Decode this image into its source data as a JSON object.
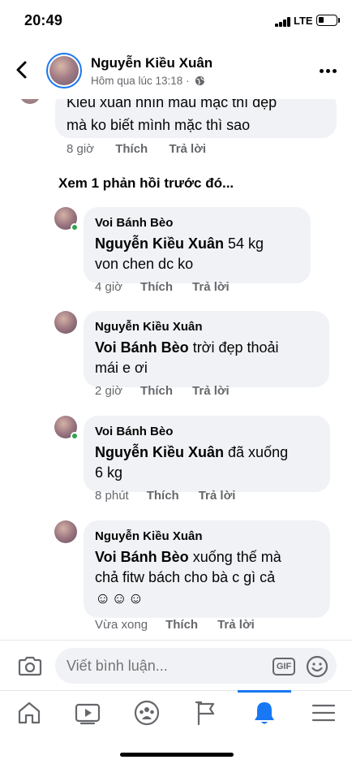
{
  "status_bar": {
    "time": "20:49",
    "network": "LTE"
  },
  "header": {
    "name": "Nguyễn Kiều Xuân",
    "subtitle": "Hôm qua lúc 13:18 · "
  },
  "partial_comment": {
    "line1": "Kiều xuân nhìn mẫu mặc  thì đẹp",
    "line2": "mà ko biết mình mặc thì sao",
    "time": "8 giờ",
    "like": "Thích",
    "reply": "Trả lời"
  },
  "view_previous": "Xem 1 phản hồi trước đó...",
  "replies": [
    {
      "author": "Voi Bánh Bèo",
      "mention": "Nguyễn Kiều Xuân",
      "text_line1": " 54 kg",
      "text_line2": "von chen dc ko",
      "time": "4 giờ",
      "like": "Thích",
      "reply": "Trả lời"
    },
    {
      "author": "Nguyễn Kiều Xuân",
      "mention": "Voi Bánh Bèo",
      "text_line1": " trời đẹp thoải",
      "text_line2": "mái e ơi",
      "time": "2 giờ",
      "like": "Thích",
      "reply": "Trả lời"
    },
    {
      "author": "Voi Bánh Bèo",
      "mention": "Nguyễn Kiều Xuân",
      "text_line1": " đã xuống",
      "text_line2": "6 kg",
      "time": "8 phút",
      "like": "Thích",
      "reply": "Trả lời"
    },
    {
      "author": "Nguyễn Kiều Xuân",
      "mention": "Voi Bánh Bèo",
      "text_line1": " xuống thế mà",
      "text_line2": "chả fitw bách cho bà c gì cả",
      "emojis": "☺☺☺",
      "time": "Vừa xong",
      "like": "Thích",
      "reply": "Trả lời"
    }
  ],
  "composer": {
    "placeholder": "Viết bình luận...",
    "gif_label": "GIF"
  },
  "tabbar": {
    "items": [
      "home-icon",
      "video-icon",
      "groups-icon",
      "flag-icon",
      "bell-icon",
      "menu-icon"
    ],
    "active": "bell-icon"
  },
  "colors": {
    "accent": "#1877f2",
    "bubble": "#f0f2f5",
    "meta": "#65676b",
    "online": "#31a24c"
  }
}
